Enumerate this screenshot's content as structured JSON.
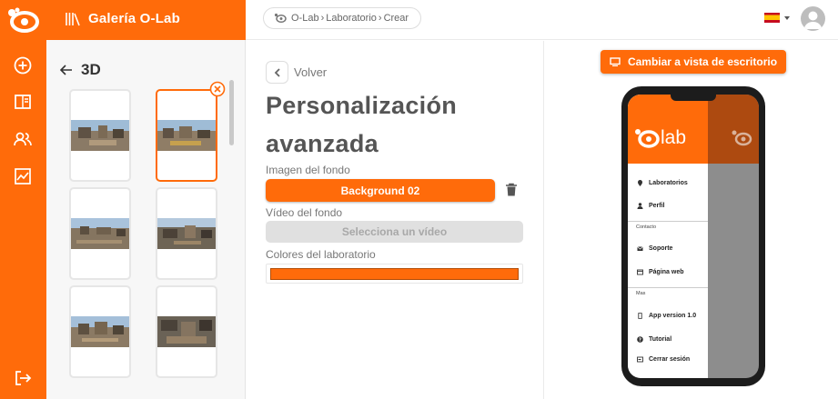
{
  "gallery": {
    "title": "Galería O-Lab",
    "section_title": "3D",
    "thumbnails": [
      {
        "selected": false
      },
      {
        "selected": true
      },
      {
        "selected": false
      },
      {
        "selected": false
      },
      {
        "selected": false
      },
      {
        "selected": false
      }
    ]
  },
  "breadcrumb": {
    "items": [
      "O-Lab",
      "Laboratorio",
      "Crear"
    ]
  },
  "language": {
    "flag": "es-flag-icon"
  },
  "form": {
    "back_label": "Volver",
    "title_line1": "Personalización",
    "title_line2": "avanzada",
    "background_image_label": "Imagen del fondo",
    "background_image_value": "Background 02",
    "background_video_label": "Vídeo del fondo",
    "background_video_button": "Selecciona un vídeo",
    "lab_colors_label": "Colores del laboratorio",
    "lab_color": "#ff6b0a"
  },
  "preview": {
    "desktop_button": "Cambiar a vista de escritorio",
    "menu": {
      "logo_text": "lab",
      "items_main": [
        "Laboratorios",
        "Perfil"
      ],
      "section_contact": "Contacto",
      "items_contact": [
        "Soporte",
        "Página web"
      ],
      "section_more": "Mas",
      "items_more": [
        "App version 1.0",
        "Tutorial",
        "Cerrar sesión"
      ]
    }
  },
  "colors": {
    "accent": "#ff6b0a",
    "accent_dark": "#ad4a10"
  }
}
